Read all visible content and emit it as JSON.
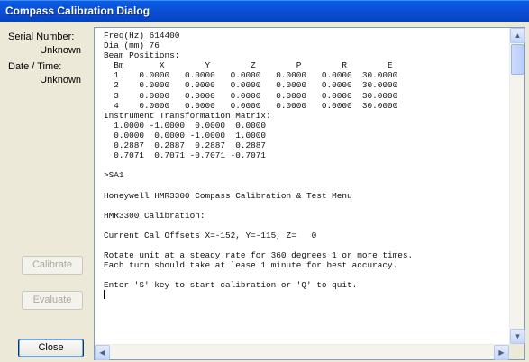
{
  "window": {
    "title": "Compass Calibration Dialog"
  },
  "info": {
    "serial_label": "Serial Number:",
    "serial_value": "Unknown",
    "datetime_label": "Date / Time:",
    "datetime_value": "Unknown"
  },
  "buttons": {
    "calibrate": "Calibrate",
    "evaluate": "Evaluate",
    "close": "Close"
  },
  "terminal": {
    "lines": [
      "Freq(Hz) 614400",
      "Dia (mm) 76",
      "Beam Positions:",
      "  Bm       X        Y        Z        P        R        E",
      "  1    0.0000   0.0000   0.0000   0.0000   0.0000  30.0000",
      "  2    0.0000   0.0000   0.0000   0.0000   0.0000  30.0000",
      "  3    0.0000   0.0000   0.0000   0.0000   0.0000  30.0000",
      "  4    0.0000   0.0000   0.0000   0.0000   0.0000  30.0000",
      "Instrument Transformation Matrix:",
      "  1.0000 -1.0000  0.0000  0.0000",
      "  0.0000  0.0000 -1.0000  1.0000",
      "  0.2887  0.2887  0.2887  0.2887",
      "  0.7071  0.7071 -0.7071 -0.7071",
      "",
      ">SA1",
      "",
      "Honeywell HMR3300 Compass Calibration & Test Menu",
      "",
      "HMR3300 Calibration:",
      "",
      "Current Cal Offsets X=-152, Y=-115, Z=   0",
      "",
      "Rotate unit at a steady rate for 360 degrees 1 or more times.",
      "Each turn should take at lease 1 minute for best accuracy.",
      "",
      "Enter 'S' key to start calibration or 'Q' to quit."
    ]
  }
}
